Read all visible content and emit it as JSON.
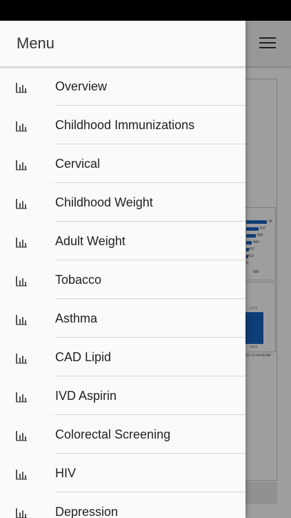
{
  "drawer": {
    "title": "Menu",
    "items": [
      {
        "label": "Overview",
        "icon": "bar-chart-icon"
      },
      {
        "label": "Childhood Immunizations",
        "icon": "bar-chart-icon"
      },
      {
        "label": "Cervical",
        "icon": "bar-chart-icon"
      },
      {
        "label": "Childhood Weight",
        "icon": "bar-chart-icon"
      },
      {
        "label": "Adult Weight",
        "icon": "bar-chart-icon"
      },
      {
        "label": "Tobacco",
        "icon": "bar-chart-icon"
      },
      {
        "label": "Asthma",
        "icon": "bar-chart-icon"
      },
      {
        "label": "CAD Lipid",
        "icon": "bar-chart-icon"
      },
      {
        "label": "IVD Aspirin",
        "icon": "bar-chart-icon"
      },
      {
        "label": "Colorectal Screening",
        "icon": "bar-chart-icon"
      },
      {
        "label": "HIV",
        "icon": "bar-chart-icon"
      },
      {
        "label": "Depression",
        "icon": "bar-chart-icon"
      }
    ]
  },
  "background": {
    "bar_values": [
      "75",
      "517",
      "500",
      "444",
      "417",
      "412",
      "0"
    ],
    "axis_label": "500",
    "value_label": "1777",
    "year_label": "2019",
    "timestamp_fragment": "2019 10:44:48 AM"
  },
  "colors": {
    "bar": "#1565c0"
  }
}
